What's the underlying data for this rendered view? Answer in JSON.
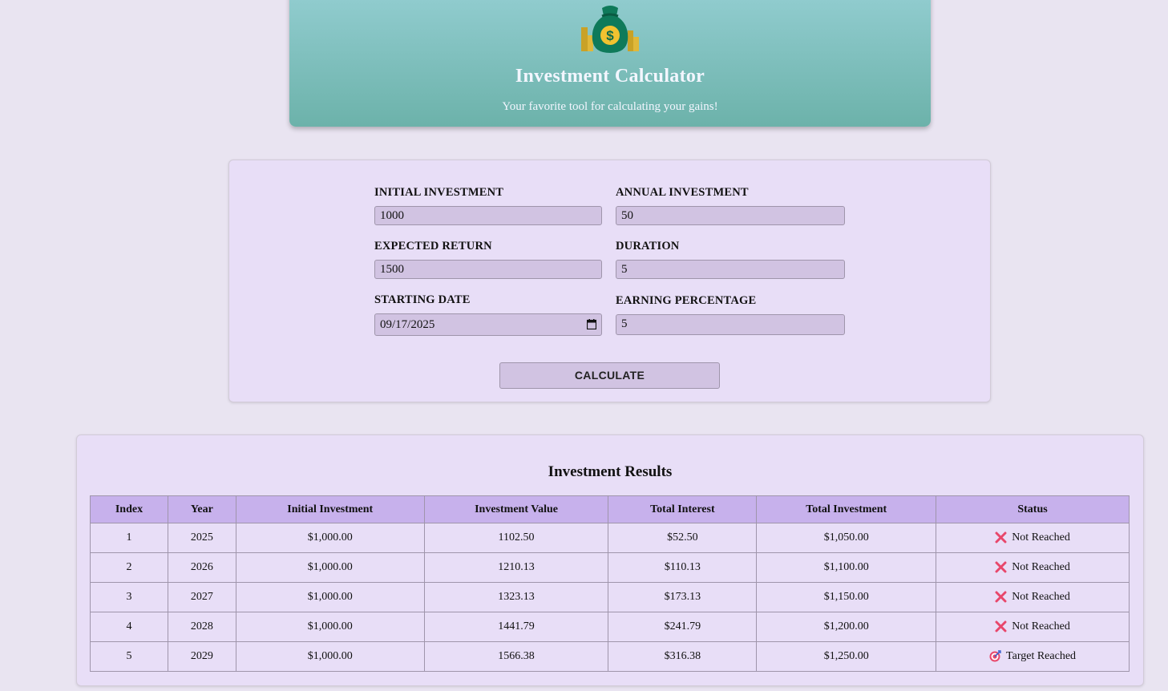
{
  "header": {
    "title": "Investment Calculator",
    "subtitle": "Your favorite tool for calculating your gains!",
    "logo_icon": "money-bag-icon"
  },
  "form": {
    "fields": [
      {
        "label": "Initial Investment",
        "value": "1000"
      },
      {
        "label": "Annual Investment",
        "value": "50"
      },
      {
        "label": "Expected Return",
        "value": "1500"
      },
      {
        "label": "Duration",
        "value": "5"
      },
      {
        "label": "Starting Date",
        "value": "09/17/2025"
      },
      {
        "label": "Earning Percentage",
        "value": "5"
      }
    ],
    "calculate_label": "CALCULATE"
  },
  "results": {
    "title": "Investment Results",
    "columns": [
      "Index",
      "Year",
      "Initial Investment",
      "Investment Value",
      "Total Interest",
      "Total Investment",
      "Status"
    ],
    "rows": [
      {
        "index": "1",
        "year": "2025",
        "initial": "$1,000.00",
        "value": "1102.50",
        "interest": "$52.50",
        "total": "$1,050.00",
        "status": "Not Reached",
        "status_icon": "cross-icon"
      },
      {
        "index": "2",
        "year": "2026",
        "initial": "$1,000.00",
        "value": "1210.13",
        "interest": "$110.13",
        "total": "$1,100.00",
        "status": "Not Reached",
        "status_icon": "cross-icon"
      },
      {
        "index": "3",
        "year": "2027",
        "initial": "$1,000.00",
        "value": "1323.13",
        "interest": "$173.13",
        "total": "$1,150.00",
        "status": "Not Reached",
        "status_icon": "cross-icon"
      },
      {
        "index": "4",
        "year": "2028",
        "initial": "$1,000.00",
        "value": "1441.79",
        "interest": "$241.79",
        "total": "$1,200.00",
        "status": "Not Reached",
        "status_icon": "cross-icon"
      },
      {
        "index": "5",
        "year": "2029",
        "initial": "$1,000.00",
        "value": "1566.38",
        "interest": "$316.38",
        "total": "$1,250.00",
        "status": "Target Reached",
        "status_icon": "target-icon"
      }
    ]
  },
  "colors": {
    "header_top": "#92cdd0",
    "header_bottom": "#6cb2aa",
    "panel": "#e8def7",
    "input": "#d1c3e2",
    "table_header": "#c7b1ec",
    "cross": "#e8476b"
  }
}
